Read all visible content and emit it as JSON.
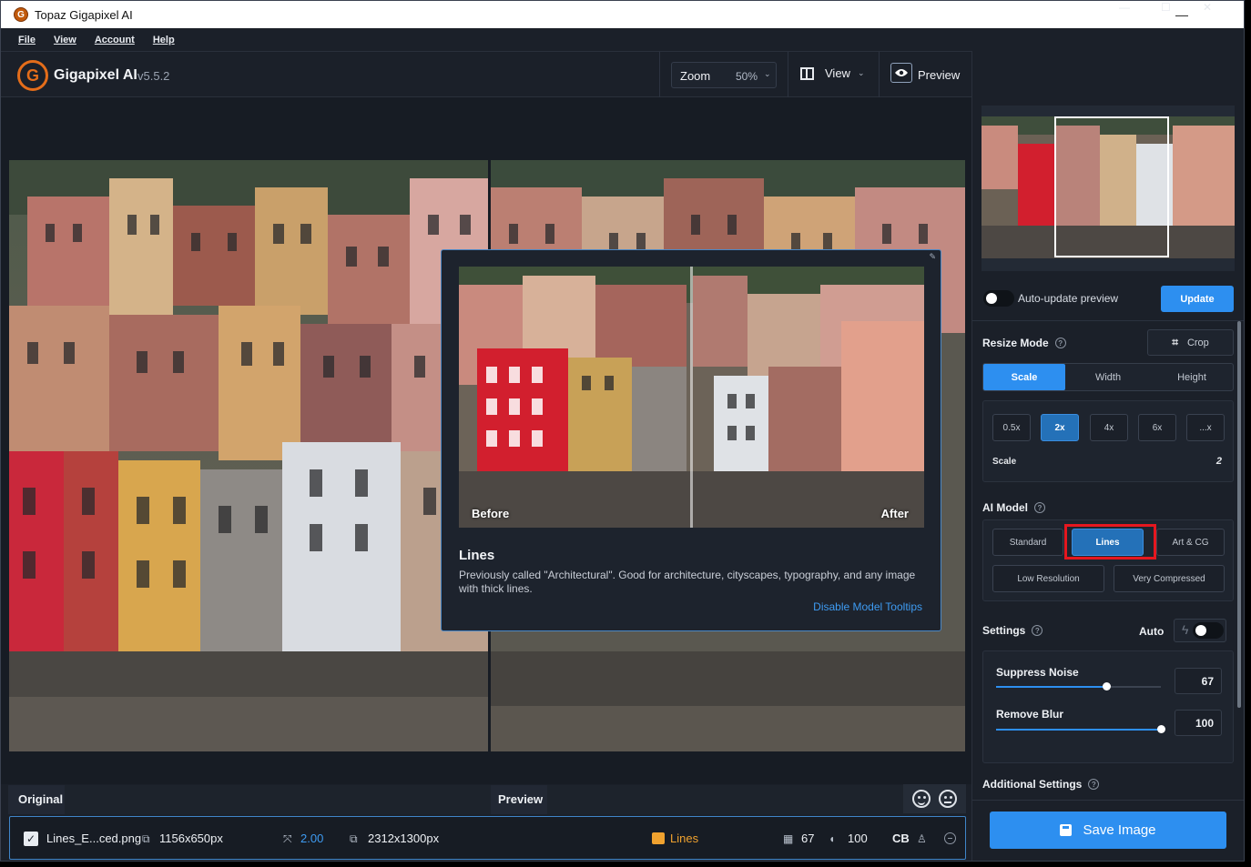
{
  "window": {
    "title": "Topaz Gigapixel AI",
    "app_icon": "gigapixel-logo-icon",
    "controls": [
      "—",
      "☐",
      "✕"
    ]
  },
  "menu": [
    "File",
    "View",
    "Account",
    "Help"
  ],
  "toolbar": {
    "logo_letter": "G",
    "brand": "Gigapixel AI",
    "version": "v5.5.2",
    "zoom_label": "Zoom",
    "zoom_value": "50%",
    "view_label": "View",
    "preview_label": "Preview"
  },
  "tooltip": {
    "before_label": "Before",
    "after_label": "After",
    "model_name": "Lines",
    "description": "Previously called \"Architectural\". Good for architecture, cityscapes, typography, and any image with thick lines.",
    "disable_link": "Disable Model Tooltips",
    "pin_icon": "pin-icon"
  },
  "panes": {
    "original_label": "Original",
    "preview_label": "Preview"
  },
  "file": {
    "name": "Lines_E...ced.png",
    "input_size": "1156x650px",
    "scale": "2.00",
    "output_size": "2312x1300px",
    "model": "Lines",
    "noise": "67",
    "blur": "100",
    "cb": "CB"
  },
  "side": {
    "auto_update_label": "Auto-update preview",
    "update_label": "Update",
    "resize_mode_label": "Resize Mode",
    "crop_label": "Crop",
    "resize_tabs": [
      "Scale",
      "Width",
      "Height"
    ],
    "active_resize_tab": "Scale",
    "scale_options": [
      "0.5x",
      "2x",
      "4x",
      "6x",
      "...x"
    ],
    "active_scale": "2x",
    "scale_label": "Scale",
    "scale_value": "2",
    "ai_model_label": "AI Model",
    "models_row1": [
      "Standard",
      "Lines",
      "Art & CG"
    ],
    "models_row2": [
      "Low Resolution",
      "Very Compressed"
    ],
    "active_model": "Lines",
    "settings_label": "Settings",
    "auto_label": "Auto",
    "suppress_noise_label": "Suppress Noise",
    "suppress_noise_value": "67",
    "suppress_noise_fraction": 0.67,
    "remove_blur_label": "Remove Blur",
    "remove_blur_value": "100",
    "remove_blur_fraction": 1.0,
    "additional_settings_label": "Additional Settings",
    "save_label": "Save Image"
  },
  "colors": {
    "accent": "#2d8ff0",
    "highlight": "#e5171f",
    "model_badge": "#f0a22f"
  }
}
